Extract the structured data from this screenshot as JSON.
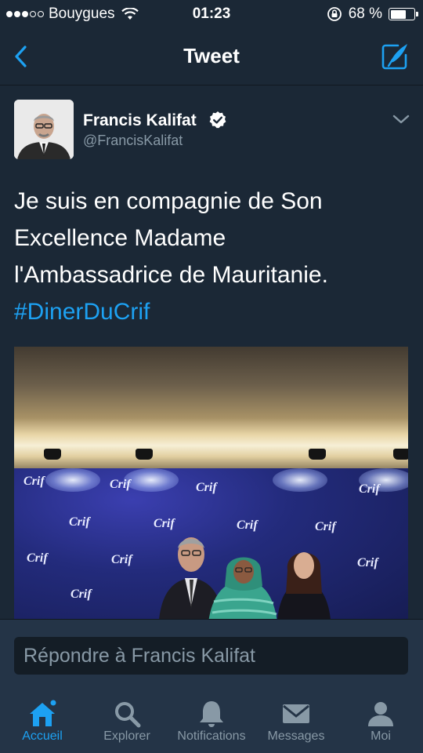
{
  "status_bar": {
    "carrier": "Bouygues",
    "time": "01:23",
    "battery_percent": "68 %",
    "battery_level": 0.68
  },
  "nav": {
    "title": "Tweet",
    "back_icon": "chevron-left-icon",
    "compose_icon": "compose-icon"
  },
  "tweet": {
    "author_name": "Francis Kalifat",
    "handle": "@FrancisKalifat",
    "verified": true,
    "text_lines": [
      "Je suis en compagnie de Son",
      "Excellence Madame",
      "l'Ambassadrice de Mauritanie."
    ],
    "hashtag": "#DinerDuCrif",
    "photo": {
      "backdrop_logo_text": "Crif"
    }
  },
  "reply": {
    "placeholder": "Répondre à Francis Kalifat"
  },
  "tabs": [
    {
      "label": "Accueil",
      "icon": "home-icon",
      "active": true,
      "badge_dot": true
    },
    {
      "label": "Explorer",
      "icon": "search-icon",
      "active": false
    },
    {
      "label": "Notifications",
      "icon": "bell-icon",
      "active": false
    },
    {
      "label": "Messages",
      "icon": "envelope-icon",
      "active": false
    },
    {
      "label": "Moi",
      "icon": "person-icon",
      "active": false
    }
  ],
  "colors": {
    "background": "#1b2836",
    "bar_background": "#243447",
    "accent_blue": "#1da1f2",
    "secondary_text": "#8899a6"
  }
}
